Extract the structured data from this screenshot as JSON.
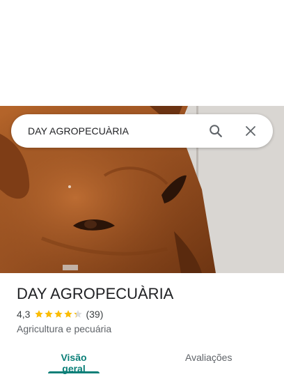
{
  "search": {
    "query": "DAY AGROPECUÀRIA"
  },
  "icons": {
    "search": "search-icon",
    "close": "close-icon"
  },
  "place": {
    "name": "DAY AGROPECUÀRIA",
    "rating_text": "4,3",
    "rating_value": 4.3,
    "rating_max": 5,
    "reviews_count": "(39)",
    "category": "Agricultura e pecuária"
  },
  "tabs": [
    {
      "label": "Visão geral",
      "active": true
    },
    {
      "label": "Avaliações",
      "active": false
    }
  ],
  "colors": {
    "accent": "#0b7f78",
    "star": "#fbbc04",
    "text": "#202124",
    "muted": "#5f6368"
  }
}
